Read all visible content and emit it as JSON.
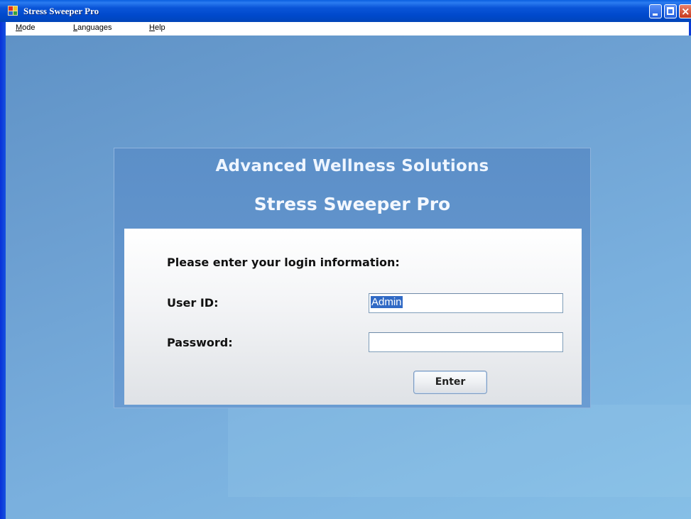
{
  "window": {
    "title": "Stress Sweeper Pro",
    "controls": {
      "minimize": "minimize",
      "maximize": "maximize",
      "close": "×"
    }
  },
  "menu": {
    "items": [
      {
        "label": "Mode"
      },
      {
        "label": "Languages"
      },
      {
        "label": "Help"
      }
    ]
  },
  "login": {
    "brand": "Advanced Wellness Solutions",
    "app_name": "Stress Sweeper Pro",
    "prompt": "Please enter your login information:",
    "user_id_label": "User ID:",
    "user_id_value": "Admin",
    "password_label": "Password:",
    "password_value": "",
    "enter_label": "Enter"
  },
  "colors": {
    "titlebar": "#0054e3",
    "background": "#6c9fd1",
    "selection": "#316ac5"
  },
  "icons": {
    "app": "app-icon",
    "minimize": "minimize-icon",
    "maximize": "maximize-icon",
    "close": "close-icon"
  }
}
